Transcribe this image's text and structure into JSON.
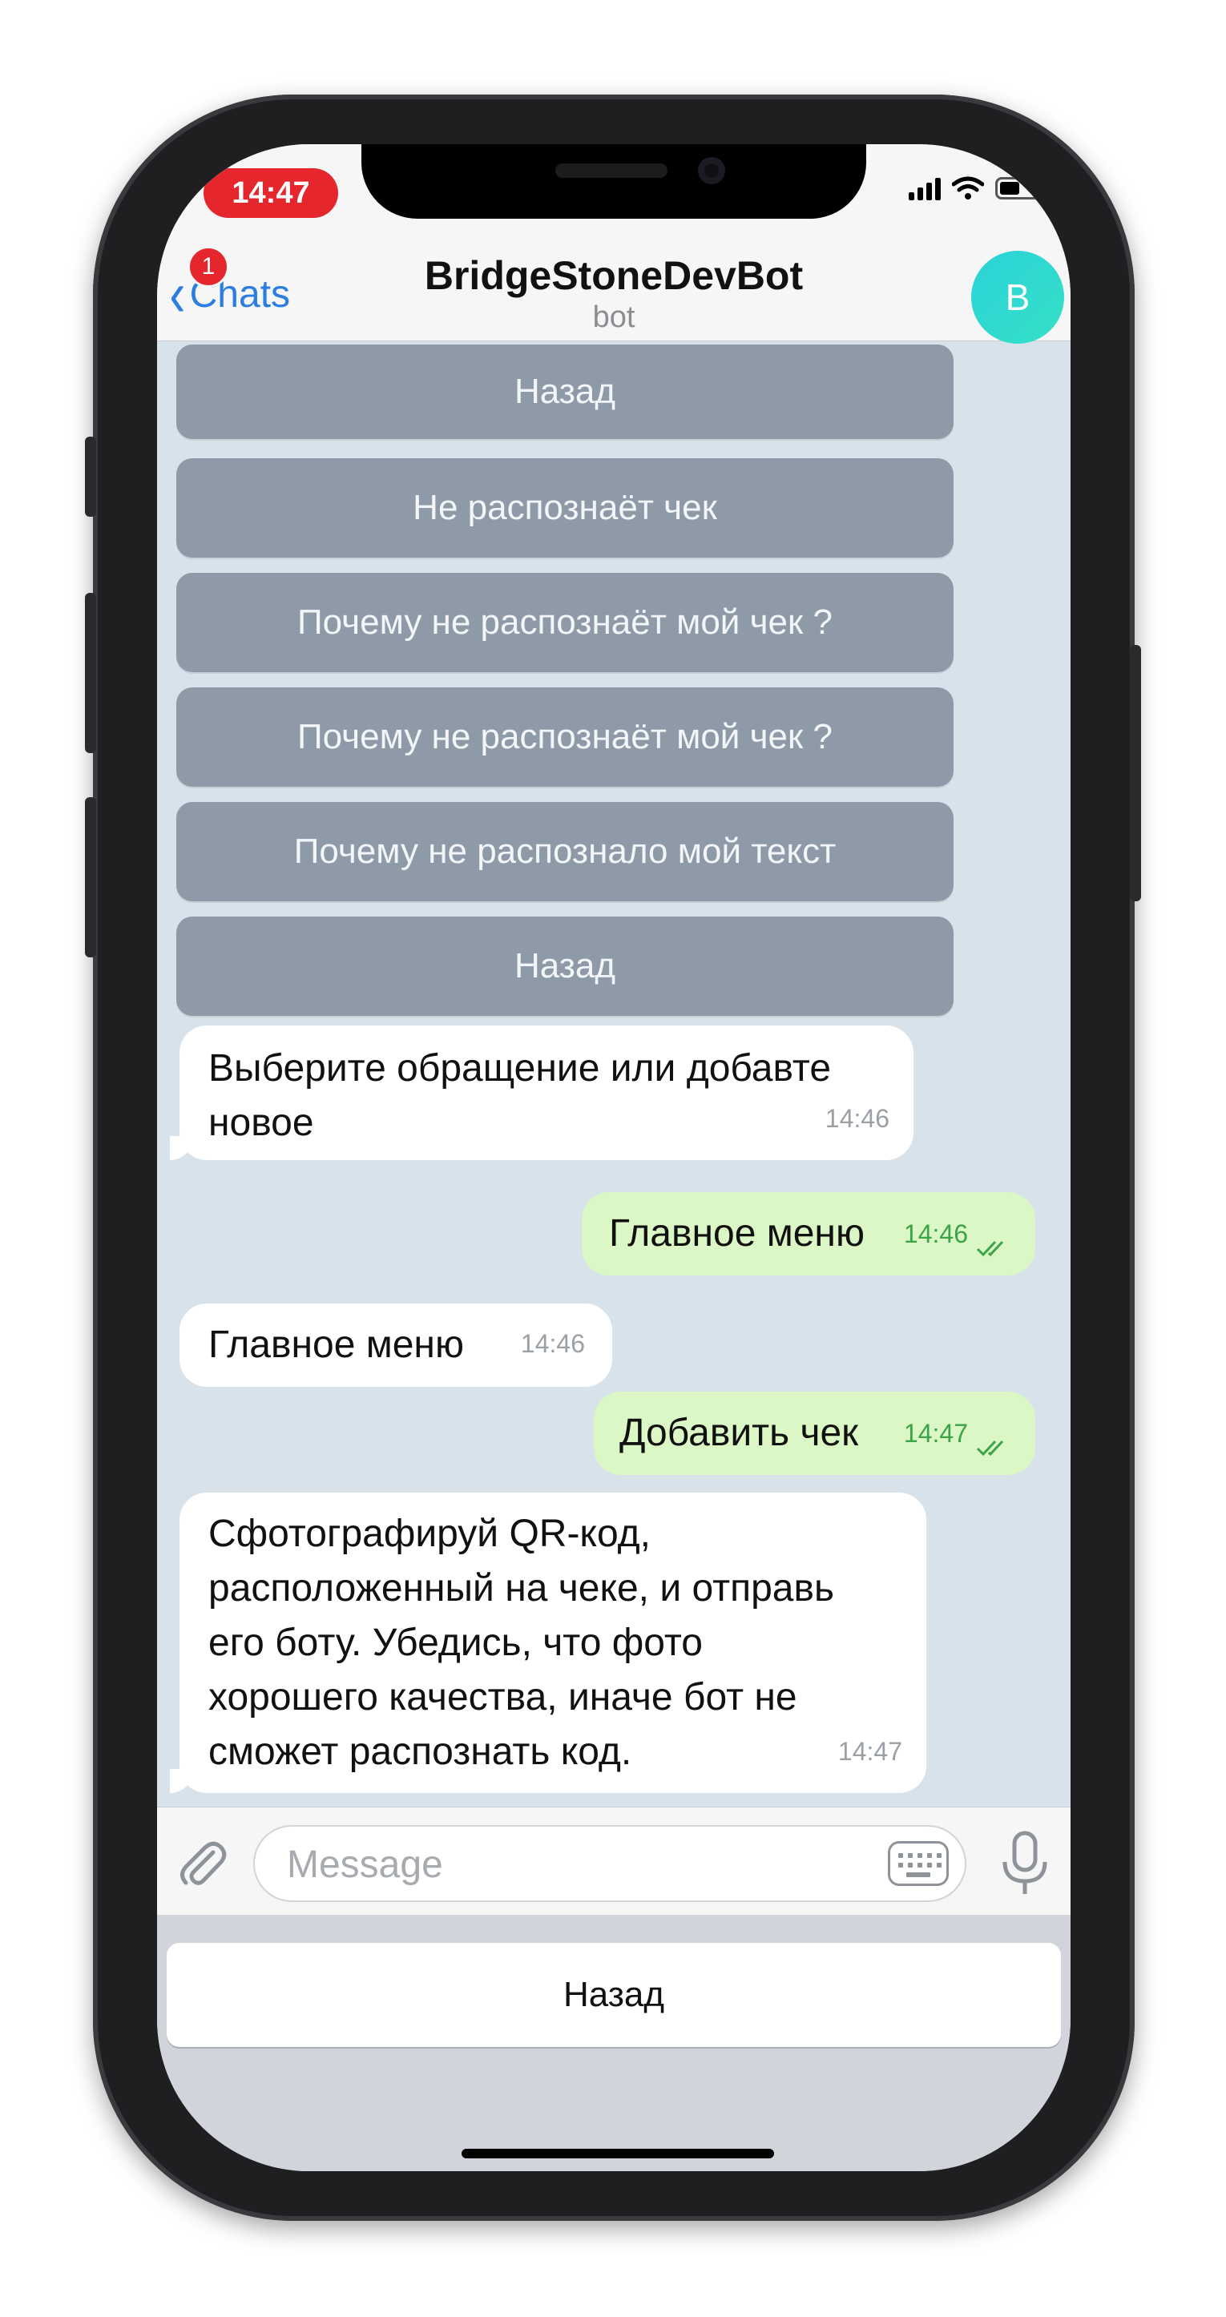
{
  "status": {
    "time": "14:47",
    "battery_level": 0.5
  },
  "nav": {
    "back_label": "Chats",
    "unread_badge": "1",
    "title": "BridgeStoneDevBot",
    "subtitle": "bot",
    "avatar_letter": "B"
  },
  "inline_buttons": [
    "Назад",
    "Не распознаёт чек",
    "Почему не распознаёт мой чек ?",
    "Почему не распознаёт мой чек ?",
    "Почему не распознало мой текст",
    "Назад"
  ],
  "messages": [
    {
      "text_line1": "Выберите обращение или добавте",
      "text_line2": "новое",
      "time": "14:46"
    },
    {
      "text": "Главное меню",
      "time": "14:46"
    },
    {
      "text": "Главное меню",
      "time": "14:46"
    },
    {
      "text": "Добавить чек",
      "time": "14:47"
    },
    {
      "lines": [
        "Сфотографируй QR-код,",
        "расположенный на чеке, и отправь",
        "его боту. Убедись, что фото",
        "хорошего качества, иначе бот не",
        "сможет распознать код."
      ],
      "time": "14:47"
    }
  ],
  "input": {
    "placeholder": "Message"
  },
  "reply_keyboard": {
    "button": "Назад"
  },
  "icons": [
    "signal-icon",
    "wifi-icon",
    "battery-icon",
    "back-chevron-icon",
    "attach-icon",
    "keyboard-icon",
    "mic-icon",
    "read-checkmarks-icon"
  ]
}
